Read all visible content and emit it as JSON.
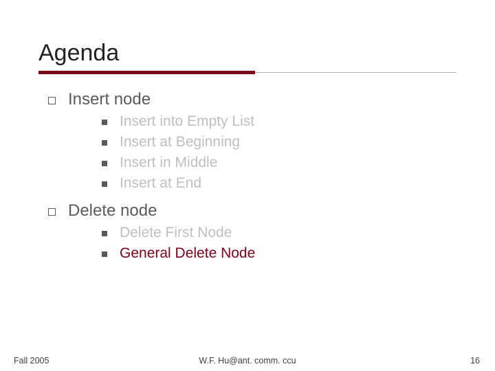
{
  "title": "Agenda",
  "sections": [
    {
      "label": "Insert node",
      "items": [
        {
          "label": "Insert into Empty List",
          "active": false
        },
        {
          "label": "Insert at Beginning",
          "active": false
        },
        {
          "label": "Insert in Middle",
          "active": false
        },
        {
          "label": "Insert at End",
          "active": false
        }
      ]
    },
    {
      "label": "Delete node",
      "items": [
        {
          "label": "Delete First Node",
          "active": false
        },
        {
          "label": "General Delete Node",
          "active": true
        }
      ]
    }
  ],
  "footer": {
    "left": "Fall 2005",
    "center": "W.F. Hu@ant. comm. ccu",
    "right": "16"
  }
}
